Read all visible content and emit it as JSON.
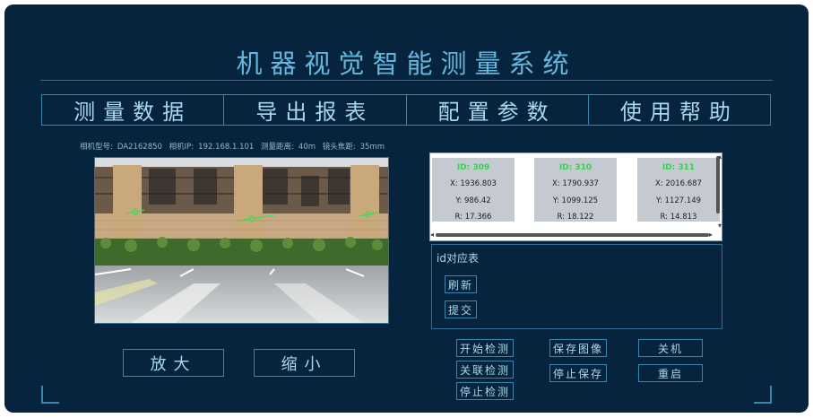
{
  "app": {
    "title": "机器视觉智能测量系统"
  },
  "menu": [
    "测量数据",
    "导出报表",
    "配置参数",
    "使用帮助"
  ],
  "camera_info": {
    "model_label": "相机型号:",
    "model_value": "DA2162850",
    "ip_label": "相机IP:",
    "ip_value": "192.168.1.101",
    "distance_label": "测量距离:",
    "distance_value": "40m",
    "focal_label": "镜头焦距:",
    "focal_value": "35mm"
  },
  "zoom": {
    "in_label": "放大",
    "out_label": "缩小"
  },
  "measurements": [
    {
      "id": "ID: 309",
      "x": "X: 1936.803",
      "y": "Y: 986.42",
      "r": "R: 17.366"
    },
    {
      "id": "ID: 310",
      "x": "X: 1790.937",
      "y": "Y: 1099.125",
      "r": "R: 18.122"
    },
    {
      "id": "ID: 311",
      "x": "X: 2016.687",
      "y": "Y: 1127.149",
      "r": "R: 14.813"
    }
  ],
  "id_table": {
    "label": "id对应表",
    "refresh": "刷新",
    "submit": "提交"
  },
  "actions": {
    "start_detect": "开始检测",
    "link_detect": "关联检测",
    "stop_detect": "停止检测",
    "save_image": "保存图像",
    "stop_save": "停止保存",
    "shutdown": "关机",
    "restart": "重启"
  },
  "colors": {
    "background": "#06243d",
    "accent": "#3a86b0",
    "text": "#a9d8ee",
    "id_green": "#2fd64a"
  }
}
